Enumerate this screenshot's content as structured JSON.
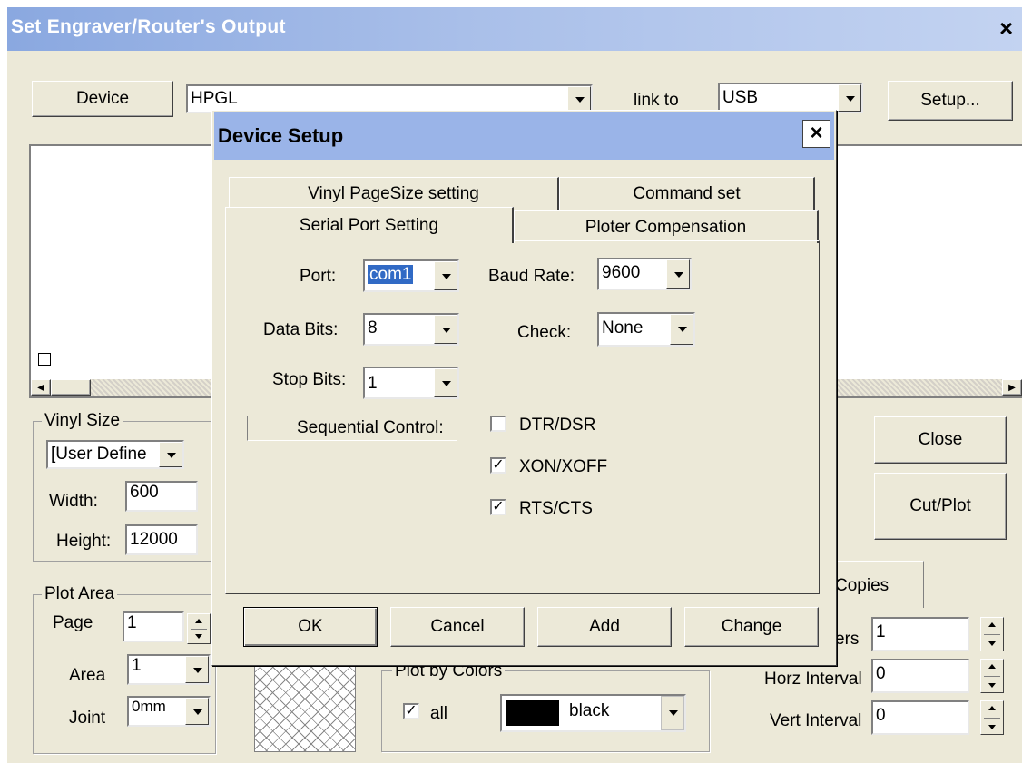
{
  "window": {
    "title": "Set Engraver/Router's Output",
    "close": "×"
  },
  "device_row": {
    "device_button": "Device",
    "device_value": "HPGL",
    "link_label": "link to",
    "link_value": "USB",
    "setup_button": "Setup..."
  },
  "vinyl_size": {
    "group": "Vinyl Size",
    "preset": "[User Define",
    "width_label": "Width:",
    "width_value": "600",
    "height_label": "Height:",
    "height_value": "12000"
  },
  "plot_area": {
    "group": "Plot Area",
    "page_label": "Page",
    "page_value": "1",
    "area_label": "Area",
    "area_value": "1",
    "joint_label": "Joint",
    "joint_value": "0mm"
  },
  "plot_colors": {
    "group": "Plot by Colors",
    "all_label": "all",
    "all_checked": true,
    "color_name": "black",
    "color_swatch": "#000000"
  },
  "copies": {
    "tab": "Copies",
    "numbers_label": "ers",
    "numbers_value": "1",
    "horz_label": "Horz Interval",
    "horz_value": "0",
    "vert_label": "Vert Interval",
    "vert_value": "0"
  },
  "right_buttons": {
    "close": "Close",
    "cut_plot": "Cut/Plot"
  },
  "dialog": {
    "title": "Device Setup",
    "close": "×",
    "tabs_back": [
      "Vinyl PageSize setting",
      "Command set"
    ],
    "tabs_front": [
      "Serial Port Setting",
      "Ploter Compensation"
    ],
    "port": {
      "label": "Port:",
      "value": "com1"
    },
    "baud": {
      "label": "Baud Rate:",
      "value": "9600"
    },
    "data_bits": {
      "label": "Data Bits:",
      "value": "8"
    },
    "check": {
      "label": "Check:",
      "value": "None"
    },
    "stop_bits": {
      "label": "Stop Bits:",
      "value": "1"
    },
    "sequential": {
      "label": "Sequential Control:"
    },
    "options": [
      {
        "label": "DTR/DSR",
        "checked": false
      },
      {
        "label": "XON/XOFF",
        "checked": true
      },
      {
        "label": "RTS/CTS",
        "checked": true
      }
    ],
    "buttons": {
      "ok": "OK",
      "cancel": "Cancel",
      "add": "Add",
      "change": "Change"
    }
  },
  "colors": {
    "titlebar_main": "#8aa8e0",
    "titlebar_dialog": "#9ab4e8",
    "face": "#ece9d8",
    "selection": "#316ac5"
  }
}
